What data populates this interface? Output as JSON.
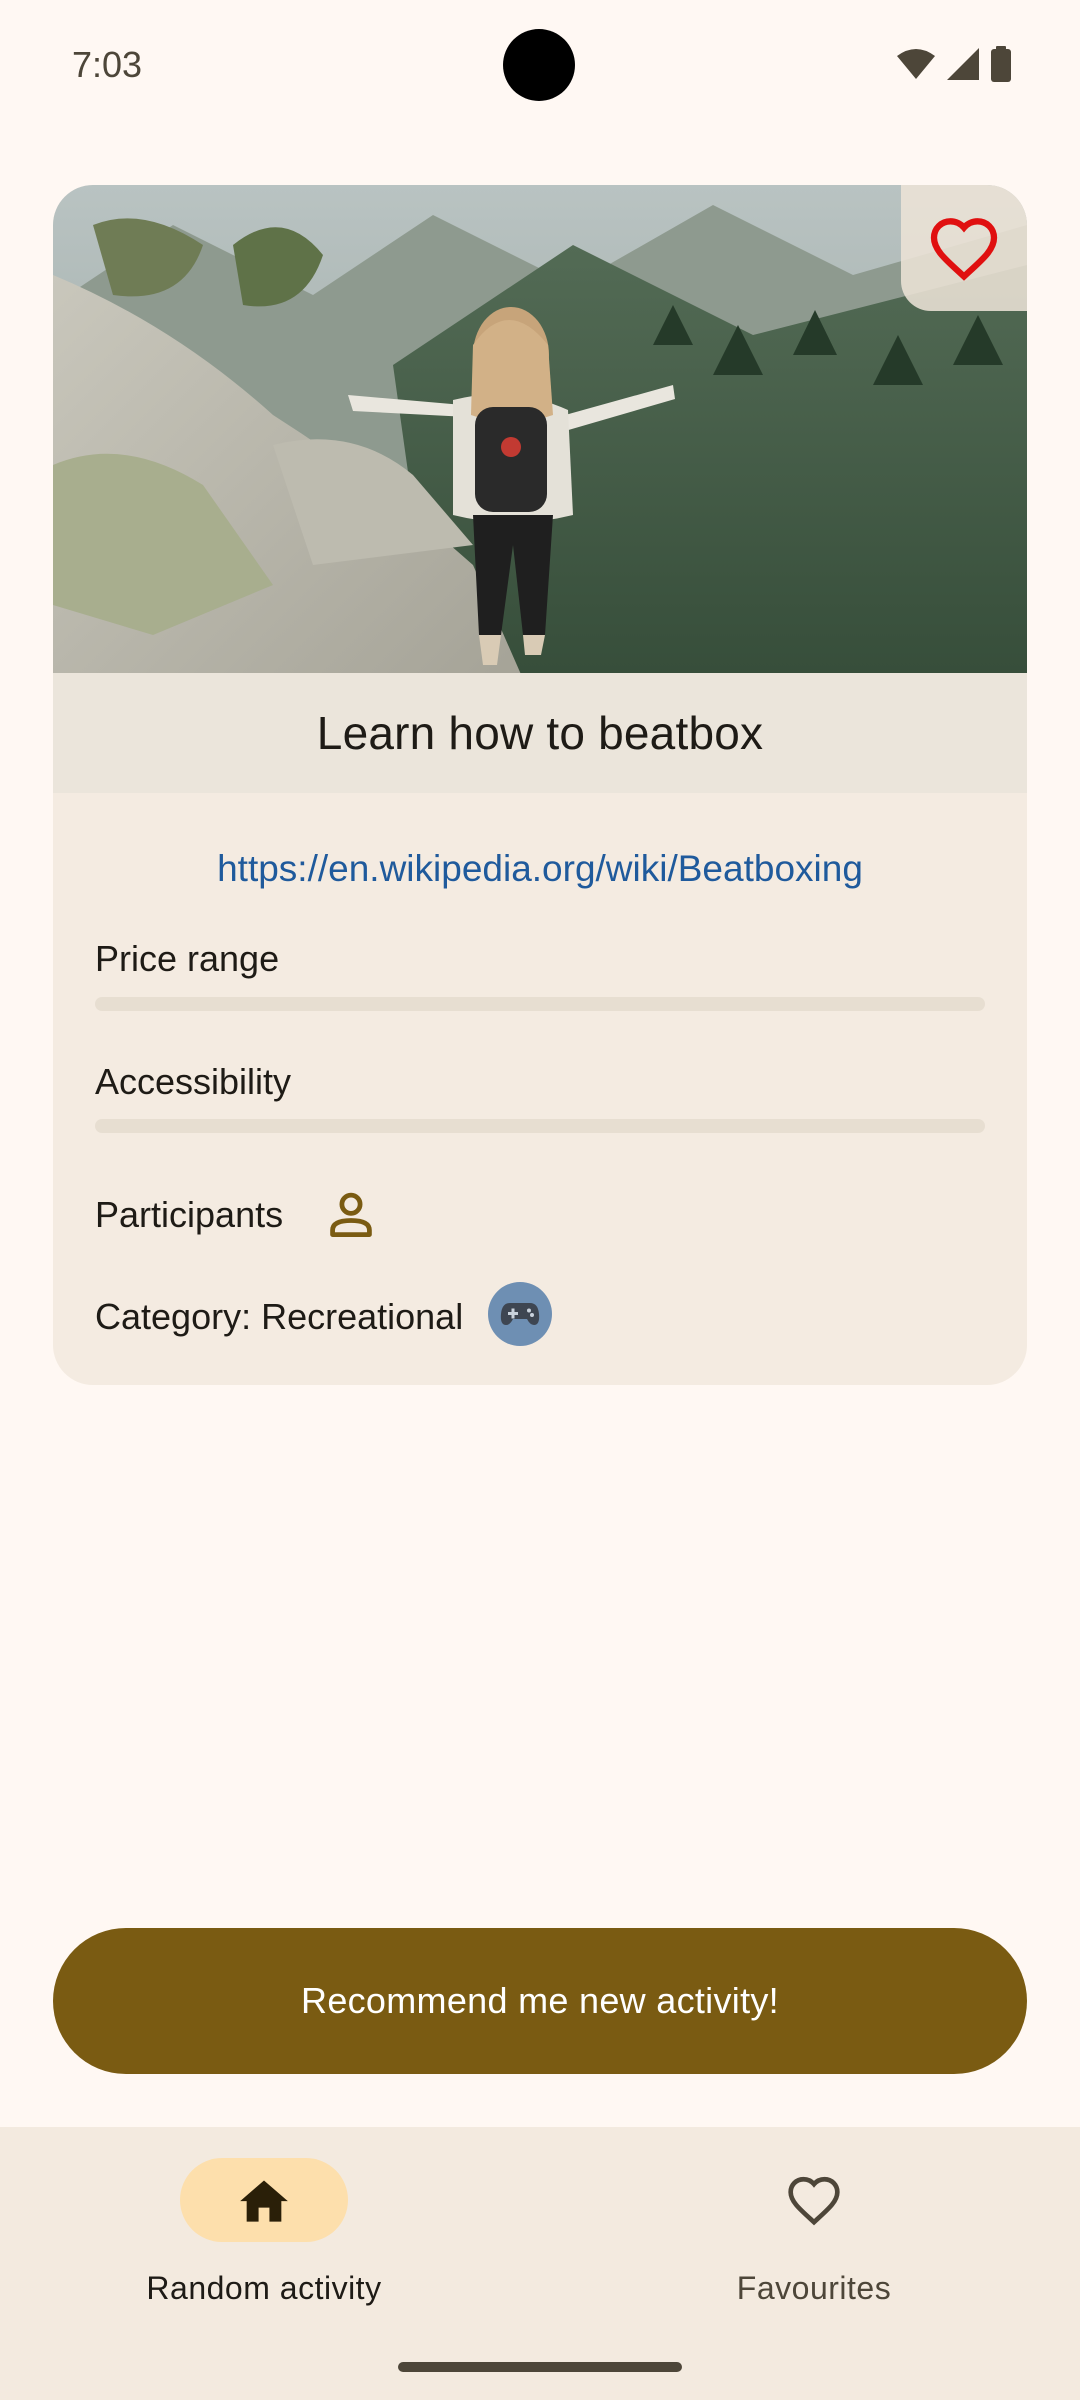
{
  "status_bar": {
    "time": "7:03",
    "icons": [
      "wifi-icon",
      "cellular-signal-icon",
      "battery-icon"
    ]
  },
  "activity": {
    "title": "Learn how to beatbox",
    "link": "https://en.wikipedia.org/wiki/Beatboxing",
    "price_label": "Price range",
    "price_level": 0,
    "accessibility_label": "Accessibility",
    "accessibility_level": 0,
    "participants_label": "Participants",
    "participants_icon": "person-icon",
    "category_label": "Category: Recreational",
    "category_icon": "gamepad-icon",
    "favourite_icon": "heart-outline-icon"
  },
  "cta": {
    "label": "Recommend me new activity!"
  },
  "nav": {
    "items": [
      {
        "label": "Random activity",
        "icon": "home-icon",
        "selected": true
      },
      {
        "label": "Favourites",
        "icon": "heart-outline-icon",
        "selected": false
      }
    ]
  },
  "colors": {
    "background": "#FFF8F3",
    "card": "#F4EBE1",
    "primary": "#7A5B12",
    "nav_pill": "#FDDFAC",
    "link": "#1F5A9C",
    "heart": "#E01010",
    "category_chip": "#6E8FB3"
  }
}
